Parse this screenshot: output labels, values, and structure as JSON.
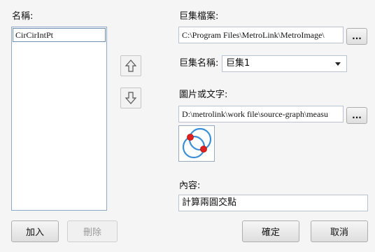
{
  "left": {
    "name_label": "名稱:",
    "items": [
      "CirCirIntPt"
    ]
  },
  "right": {
    "macro_file_label": "巨集檔案:",
    "macro_file_value": "C:\\Program Files\\MetroLink\\MetroImage\\",
    "macro_name_label": "巨集名稱:",
    "macro_name_value": "巨集1",
    "image_label": "圖片或文字:",
    "image_value": "D:\\metrolink\\work file\\source-graph\\measu",
    "content_label": "內容:",
    "content_value": "計算兩圓交點",
    "browse_label": "...",
    "preview_icon": "circle-circle-intersection-icon"
  },
  "buttons": {
    "add": "加入",
    "delete": "刪除",
    "ok": "確定",
    "cancel": "取消"
  },
  "icons": {
    "move_up": "arrow-up-icon",
    "move_down": "arrow-down-icon"
  },
  "colors": {
    "icon_circle": "#3b8fd6",
    "icon_point": "#e02020"
  }
}
